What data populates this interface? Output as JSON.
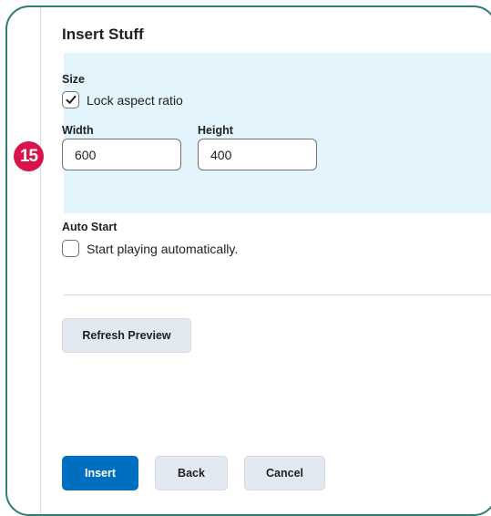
{
  "panel": {
    "title": "Insert Stuff"
  },
  "size": {
    "heading": "Size",
    "lock_aspect_label": "Lock aspect ratio",
    "lock_aspect_checked": true,
    "width_label": "Width",
    "width_value": "600",
    "height_label": "Height",
    "height_value": "400"
  },
  "auto_start": {
    "heading": "Auto Start",
    "checkbox_label": "Start playing automatically.",
    "checked": false
  },
  "buttons": {
    "refresh_preview": "Refresh Preview",
    "insert": "Insert",
    "back": "Back",
    "cancel": "Cancel"
  },
  "annotation": {
    "step_number": "15",
    "color": "#d8144a"
  },
  "colors": {
    "accent": "#006fbf",
    "frame": "#2e7d74",
    "highlight": "#e3f4fd"
  }
}
